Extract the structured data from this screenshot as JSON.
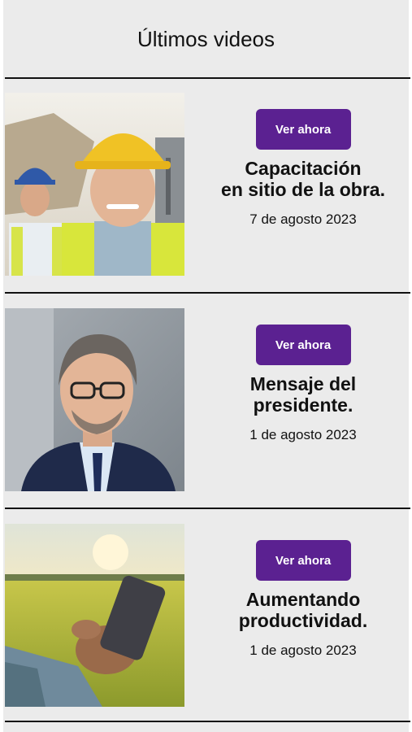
{
  "header": {
    "title": "Últimos videos"
  },
  "videos": [
    {
      "button_label": "Ver ahora",
      "title_line1": "Capacitación",
      "title_line2": "en sitio de la obra.",
      "date": "7 de agosto 2023",
      "thumbnail": "construction-workers-photo"
    },
    {
      "button_label": "Ver ahora",
      "title_line1": "Mensaje del",
      "title_line2": "presidente.",
      "date": "1 de agosto 2023",
      "thumbnail": "president-portrait-photo"
    },
    {
      "button_label": "Ver ahora",
      "title_line1": "Aumentando",
      "title_line2": "productividad.",
      "date": "1 de agosto 2023",
      "thumbnail": "farm-phone-photo"
    }
  ],
  "colors": {
    "accent": "#5b2191",
    "background": "#ebebeb",
    "divider": "#111111"
  }
}
